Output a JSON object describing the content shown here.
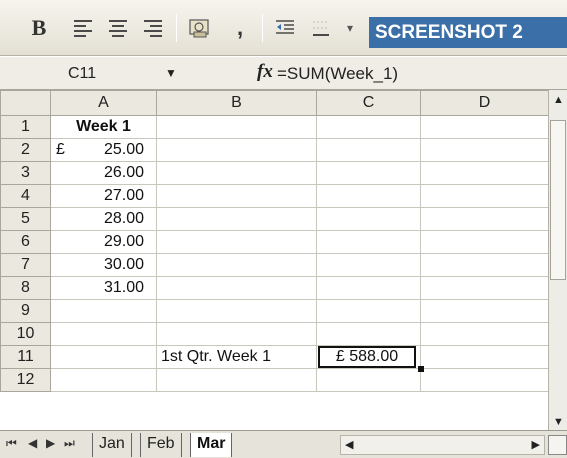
{
  "toolbar": {
    "bold_label": "B",
    "comma_label": ",",
    "badge_text": "SCREENSHOT 2",
    "icons": [
      "align-left-icon",
      "align-center-icon",
      "align-right-icon",
      "currency-icon",
      "decrease-indent-icon",
      "borders-icon"
    ]
  },
  "formula_bar": {
    "cell_ref": "C11",
    "fx_label": "fx",
    "formula": "=SUM(Week_1)"
  },
  "grid": {
    "columns": [
      "A",
      "B",
      "C",
      "D"
    ],
    "rows": [
      "1",
      "2",
      "3",
      "4",
      "5",
      "6",
      "7",
      "8",
      "9",
      "10",
      "11",
      "12"
    ],
    "a1_header": "Week 1",
    "currency_symbol": "£",
    "values": [
      "25.00",
      "26.00",
      "27.00",
      "28.00",
      "29.00",
      "30.00",
      "31.00"
    ],
    "b11_label": "1st Qtr. Week 1",
    "c11_value": "£ 588.00",
    "selected_cell": "C11"
  },
  "sheet_tabs": {
    "tabs": [
      "Jan",
      "Feb",
      "Mar"
    ],
    "active": "Mar"
  },
  "colors": {
    "badge": "#3b6fa8",
    "header_bg": "#ebe8df",
    "selected_column_bg": "#d8dae2"
  }
}
